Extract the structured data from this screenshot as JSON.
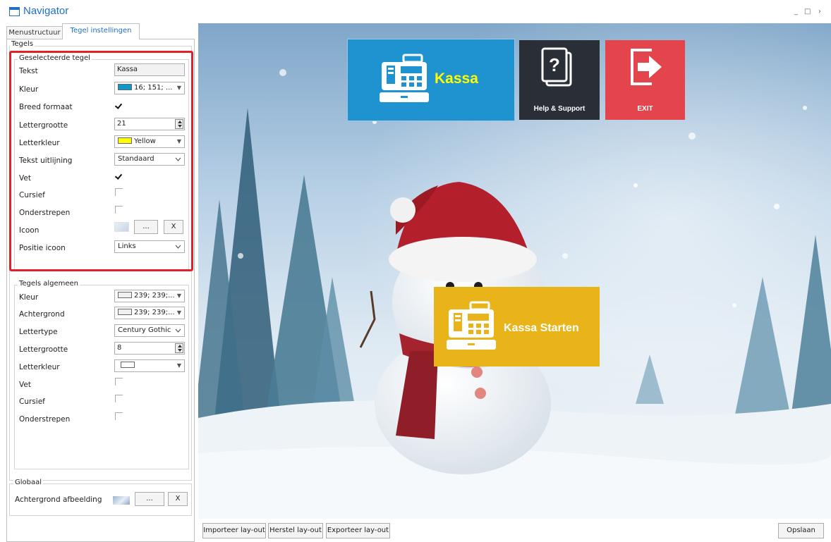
{
  "window": {
    "title": "Navigator",
    "controls": [
      "_",
      "□",
      "›"
    ]
  },
  "tabs": [
    {
      "label": "Menustructuur"
    },
    {
      "label": "Tegel instellingen"
    }
  ],
  "tegels_group": {
    "label": "Tegels"
  },
  "selected_tile": {
    "legend": "Geselecteerde tegel",
    "tekst": {
      "label": "Tekst",
      "value": "Kassa"
    },
    "kleur": {
      "label": "Kleur",
      "value": "16; 151; ...",
      "swatch": "#1097cc"
    },
    "breed": {
      "label": "Breed formaat",
      "checked": true
    },
    "lettergrootte": {
      "label": "Lettergrootte",
      "value": "21"
    },
    "letterkleur": {
      "label": "Letterkleur",
      "value": "Yellow",
      "swatch": "#ffff00"
    },
    "uitlijning": {
      "label": "Tekst uitlijning",
      "value": "Standaard"
    },
    "vet": {
      "label": "Vet",
      "checked": true
    },
    "cursief": {
      "label": "Cursief",
      "checked": false
    },
    "onderstrepen": {
      "label": "Onderstrepen",
      "checked": false
    },
    "icoon": {
      "label": "Icoon",
      "browse": "...",
      "clear": "X"
    },
    "positie": {
      "label": "Positie icoon",
      "value": "Links"
    }
  },
  "general": {
    "legend": "Tegels algemeen",
    "kleur": {
      "label": "Kleur",
      "value": "239; 239;...",
      "swatch": "#efefef"
    },
    "achtergrond": {
      "label": "Achtergrond",
      "value": "239; 239;...",
      "swatch": "#efefef"
    },
    "lettertype": {
      "label": "Lettertype",
      "value": "Century Gothic"
    },
    "lettergrootte": {
      "label": "Lettergrootte",
      "value": "8"
    },
    "letterkleur": {
      "label": "Letterkleur",
      "swatch": "#ffffff"
    },
    "vet": {
      "label": "Vet",
      "checked": false
    },
    "cursief": {
      "label": "Cursief",
      "checked": false
    },
    "onderstrepen": {
      "label": "Onderstrepen",
      "checked": false
    }
  },
  "global": {
    "legend": "Globaal",
    "achtergrond": {
      "label": "Achtergrond afbeelding",
      "browse": "...",
      "clear": "X"
    }
  },
  "tiles": [
    {
      "name": "kassa",
      "label": "Kassa",
      "color": "#1f93d0",
      "text_color": "#ffff00"
    },
    {
      "name": "help",
      "label": "Help & Support",
      "color": "#2a2e36",
      "text_color": "#ffffff"
    },
    {
      "name": "exit",
      "label": "EXIT",
      "color": "#e4454d",
      "text_color": "#ffffff"
    },
    {
      "name": "kassa-starten",
      "label": "Kassa Starten",
      "color": "#e8b41a",
      "text_color": "#ffffff"
    }
  ],
  "bottom": {
    "import": "Importeer lay-out",
    "reset": "Herstel lay-out",
    "export": "Exporteer lay-out",
    "save": "Opslaan"
  }
}
